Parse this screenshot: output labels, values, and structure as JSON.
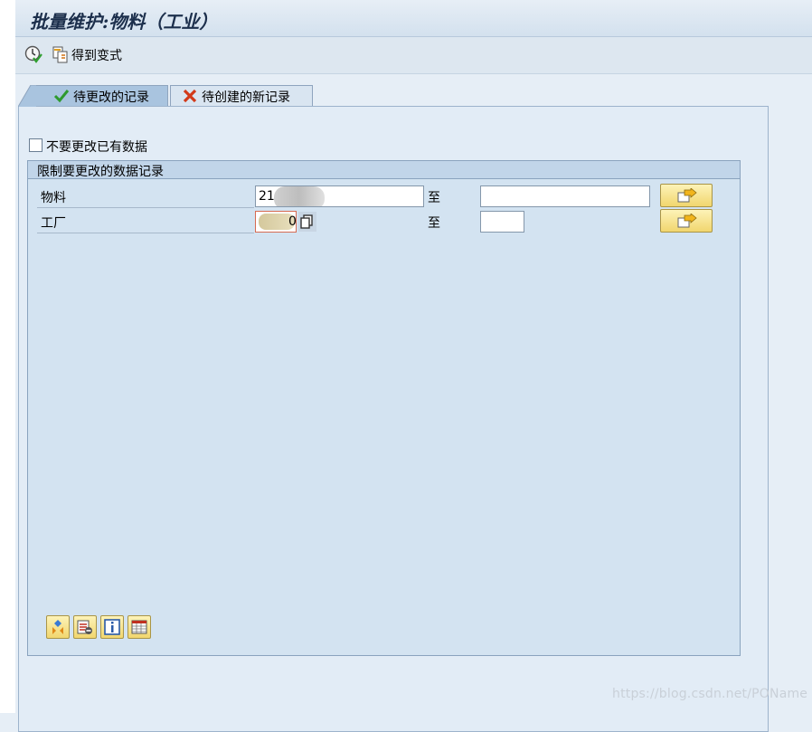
{
  "window": {
    "title": "批量维护:物料（工业）"
  },
  "toolbar": {
    "execute_icon": "execute-clock-icon",
    "variant_icon": "get-variant-icon",
    "get_variant_label": "得到变式"
  },
  "tabs": [
    {
      "label": "待更改的记录",
      "icon": "checkmark-icon",
      "active": true
    },
    {
      "label": "待创建的新记录",
      "icon": "red-x-icon",
      "active": false
    }
  ],
  "options": {
    "do_not_change_existing_label": "不要更改已有数据",
    "checked": false
  },
  "restrict_group": {
    "title": "限制要更改的数据记录",
    "to_label": "至",
    "rows": [
      {
        "label": "物料",
        "from_value": "21",
        "to_value": ""
      },
      {
        "label": "工厂",
        "from_value_tail": "0",
        "to_value": ""
      }
    ]
  },
  "bottom_buttons": [
    "add-field-icon",
    "delete-field-icon",
    "info-icon",
    "table-settings-icon"
  ],
  "watermark": "https://blog.csdn.net/POName",
  "colors": {
    "background": "#e6eef6",
    "group": "#d3e3f1",
    "active_tab": "#a9c4df",
    "button_yellow": "#f1d66e",
    "title_text": "#1c2f4c"
  }
}
